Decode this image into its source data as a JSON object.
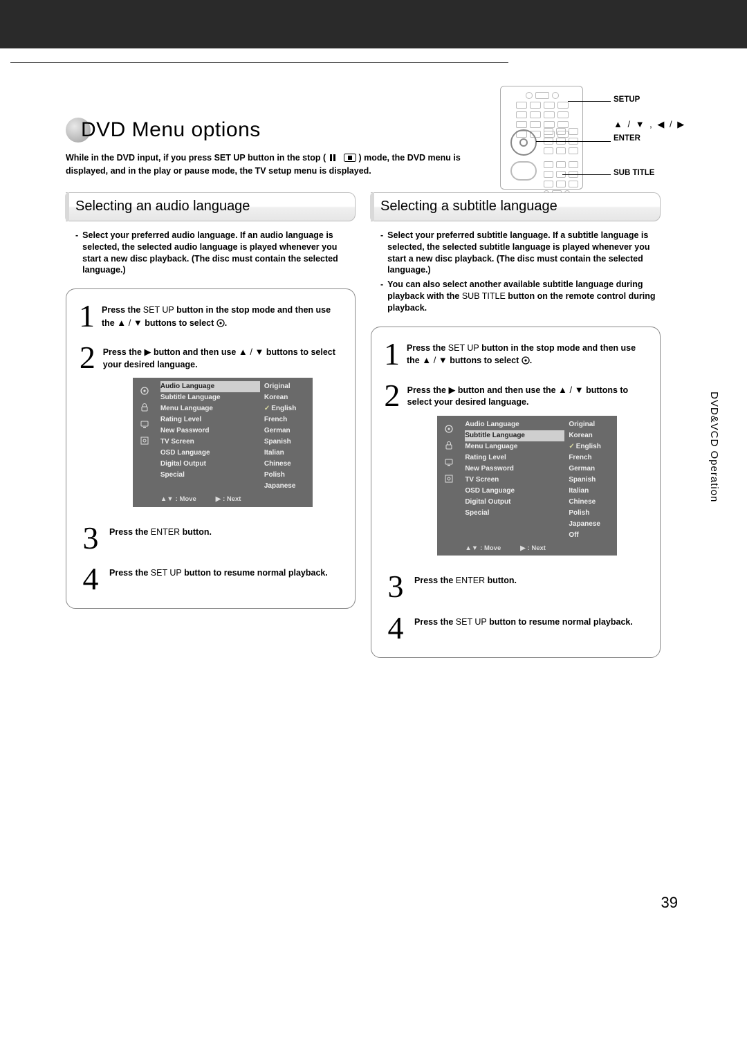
{
  "header": {
    "title": "DVD Menu options",
    "intro_pre": "While in the DVD input, if you press ",
    "intro_setup": "SET UP",
    "intro_mid1": " button in the stop (",
    "intro_mid2": ") mode, the DVD menu is displayed, and in the play or pause mode, the TV setup menu is displayed.",
    "callout_setup": "SETUP",
    "callout_arrows": "▲ / ▼ , ◀ / ▶",
    "callout_enter": "ENTER",
    "callout_subtitle": "SUB TITLE"
  },
  "side_tab": "DVD&VCD Operation",
  "page_number": "39",
  "audio": {
    "heading": "Selecting an audio language",
    "desc_dash": "-",
    "desc": "Select your preferred audio language. If an audio language is selected, the selected audio language is played whenever you start a new disc playback. (The disc must contain the selected language.)",
    "step1_a": "Press the ",
    "step1_setup": "SET UP",
    "step1_b": " button in the stop mode and then use the ",
    "step1_arrows": "▲ / ▼",
    "step1_c": " buttons to select ",
    "step1_d": ".",
    "step2_a": "Press the ",
    "step2_btn": "▶",
    "step2_b": " button and then use ",
    "step2_arrows": "▲ / ▼",
    "step2_c": " buttons to select your desired language.",
    "step3_a": "Press the ",
    "step3_enter": "ENTER",
    "step3_b": " button.",
    "step4_a": "Press the ",
    "step4_setup": "SET UP",
    "step4_b": " button to resume normal playback.",
    "osd": {
      "left_items": [
        "Audio Language",
        "Subtitle Language",
        "Menu Language",
        "Rating Level",
        "New Password",
        "TV Screen",
        "OSD Language",
        "Digital Output",
        "Special"
      ],
      "selected_index": 0,
      "right_items": [
        "Original",
        "Korean",
        "English",
        "French",
        "German",
        "Spanish",
        "Italian",
        "Chinese",
        "Polish",
        "Japanese"
      ],
      "checked_index": 2,
      "footer_move": ": Move",
      "footer_next": ": Next"
    }
  },
  "subtitle": {
    "heading": "Selecting a subtitle language",
    "desc_dash": "-",
    "desc1": "Select your preferred subtitle language. If a subtitle language is selected, the selected subtitle language is played whenever you start a new disc playback. (The disc must contain the selected language.)",
    "desc2_a": "You can also select another available subtitle language during playback with the ",
    "desc2_sub": "SUB TITLE",
    "desc2_b": " button on the remote control during playback.",
    "step1_a": "Press the ",
    "step1_setup": "SET UP",
    "step1_b": " button in the stop mode and then use the ",
    "step1_arrows": "▲ / ▼",
    "step1_c": " buttons to select ",
    "step1_d": ".",
    "step2_a": "Press the ",
    "step2_btn": "▶",
    "step2_b": " button and then use the ",
    "step2_arrows": "▲ / ▼",
    "step2_c": " buttons to select your desired language.",
    "step3_a": "Press the ",
    "step3_enter": "ENTER",
    "step3_b": " button.",
    "step4_a": "Press the ",
    "step4_setup": "SET UP",
    "step4_b": " button to resume normal playback.",
    "osd": {
      "left_items": [
        "Audio Language",
        "Subtitle Language",
        "Menu Language",
        "Rating Level",
        "New Password",
        "TV Screen",
        "OSD Language",
        "Digital Output",
        "Special"
      ],
      "selected_index": 1,
      "right_items": [
        "Original",
        "Korean",
        "English",
        "French",
        "German",
        "Spanish",
        "Italian",
        "Chinese",
        "Polish",
        "Japanese",
        "Off"
      ],
      "checked_index": 2,
      "footer_move": ": Move",
      "footer_next": ": Next"
    }
  }
}
